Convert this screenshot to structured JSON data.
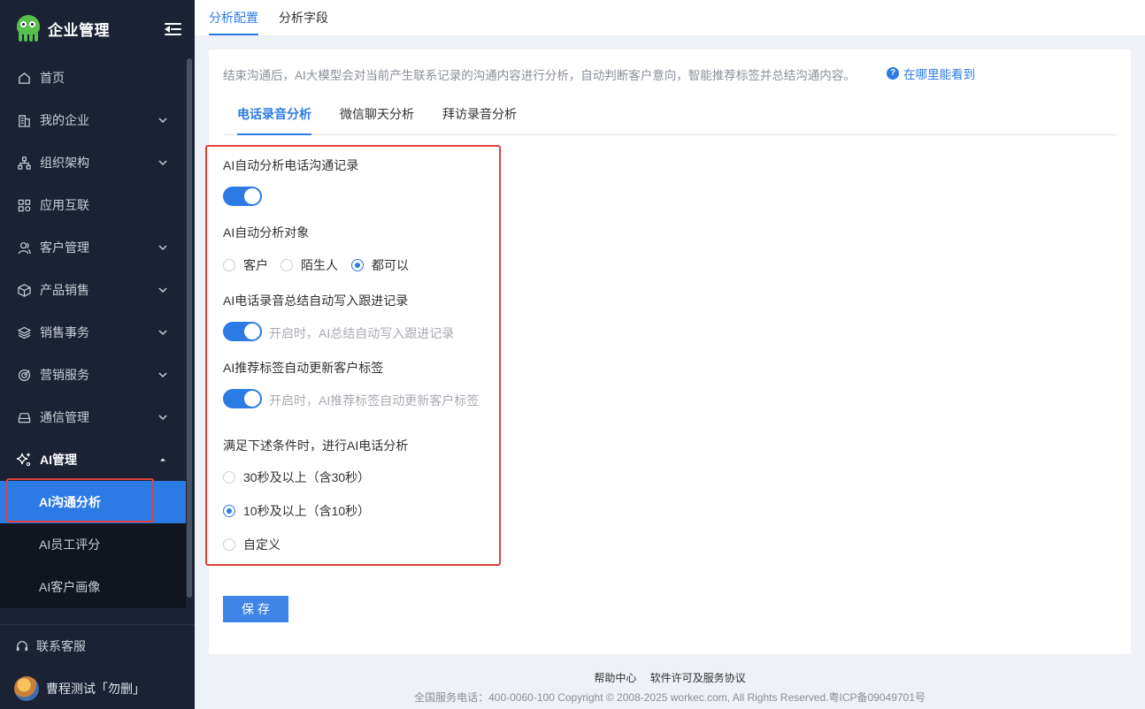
{
  "brand": {
    "title": "企业管理"
  },
  "sidebar": {
    "items": [
      {
        "label": "首页",
        "icon": "home-icon"
      },
      {
        "label": "我的企业",
        "icon": "building-icon"
      },
      {
        "label": "组织架构",
        "icon": "org-chart-icon"
      },
      {
        "label": "应用互联",
        "icon": "apps-grid-icon"
      },
      {
        "label": "客户管理",
        "icon": "customers-icon"
      },
      {
        "label": "产品销售",
        "icon": "box-icon"
      },
      {
        "label": "销售事务",
        "icon": "layers-icon"
      },
      {
        "label": "营销服务",
        "icon": "target-icon"
      },
      {
        "label": "通信管理",
        "icon": "inbox-icon"
      },
      {
        "label": "AI管理",
        "icon": "sparkle-icon"
      }
    ],
    "sub_items": [
      {
        "label": "AI沟通分析"
      },
      {
        "label": "AI员工评分"
      },
      {
        "label": "AI客户画像"
      }
    ],
    "support": "联系客服",
    "user": "曹程测试「勿删」"
  },
  "top_tabs": [
    "分析配置",
    "分析字段"
  ],
  "main": {
    "description": "结束沟通后，AI大模型会对当前产生联系记录的沟通内容进行分析，自动判断客户意向，智能推荐标签并总结沟通内容。",
    "help_link": "在哪里能看到",
    "sub_tabs": [
      "电话录音分析",
      "微信聊天分析",
      "拜访录音分析"
    ],
    "form": {
      "auto_analyze_label": "AI自动分析电话沟通记录",
      "auto_analyze_on": true,
      "target_label": "AI自动分析对象",
      "target_options": [
        "客户",
        "陌生人",
        "都可以"
      ],
      "target_selected": "都可以",
      "summary_label": "AI电话录音总结自动写入跟进记录",
      "summary_on": true,
      "summary_hint": "开启时，AI总结自动写入跟进记录",
      "tag_label": "AI推荐标签自动更新客户标签",
      "tag_on": true,
      "tag_hint": "开启时，AI推荐标签自动更新客户标签",
      "condition_label": "满足下述条件时，进行AI电话分析",
      "condition_options": [
        "30秒及以上（含30秒）",
        "10秒及以上（含10秒）",
        "自定义"
      ],
      "condition_selected": "10秒及以上（含10秒）"
    },
    "save_label": "保存"
  },
  "footer": {
    "links": [
      "帮助中心",
      "软件许可及服务协议"
    ],
    "copyright": "全国服务电话：400-0060-100 Copyright © 2008-2025 workec.com, All Rights Reserved.粤ICP备09049701号"
  },
  "colors": {
    "accent": "#2c7be5",
    "sidebar_bg": "#1b2233",
    "highlight": "#e0423b"
  }
}
